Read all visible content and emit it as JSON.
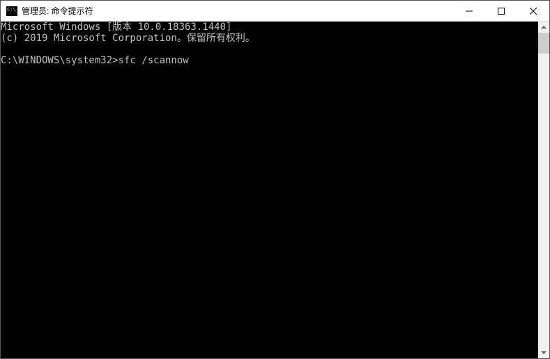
{
  "titlebar": {
    "title": "管理员: 命令提示符"
  },
  "console": {
    "line1": "Microsoft Windows [版本 10.0.18363.1440]",
    "line2": "(c) 2019 Microsoft Corporation。保留所有权利。",
    "blank": "",
    "prompt": "C:\\WINDOWS\\system32>",
    "command": "sfc /scannow"
  }
}
